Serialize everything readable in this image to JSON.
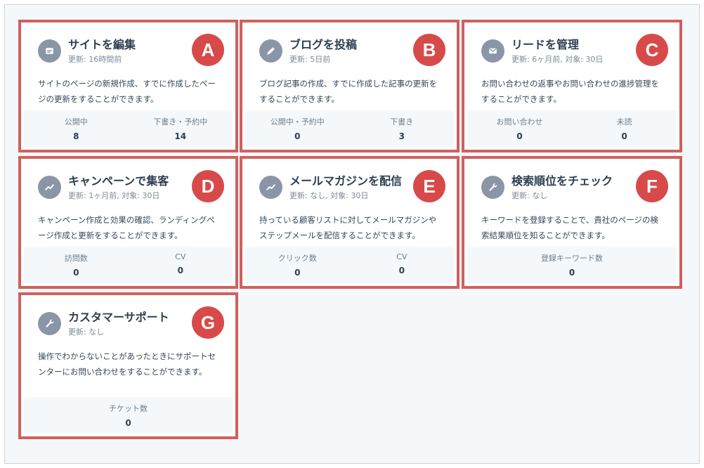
{
  "cards": [
    {
      "title": "サイトを編集",
      "updated": "更新: 16時間前",
      "description": "サイトのページの新規作成、すでに作成したページの更新をすることができます。",
      "badge": "A",
      "icon": "page-icon",
      "stats": [
        {
          "label": "公開中",
          "value": "8"
        },
        {
          "label": "下書き・予約中",
          "value": "14"
        }
      ]
    },
    {
      "title": "ブログを投稿",
      "updated": "更新: 5日前",
      "description": "ブログ記事の作成、すでに作成した記事の更新をすることができます。",
      "badge": "B",
      "icon": "pencil-icon",
      "stats": [
        {
          "label": "公開中・予約中",
          "value": "0"
        },
        {
          "label": "下書き",
          "value": "3"
        }
      ]
    },
    {
      "title": "リードを管理",
      "updated": "更新: 6ヶ月前, 対象: 30日",
      "description": "お問い合わせの返事やお問い合わせの進捗管理をすることができます。",
      "badge": "C",
      "icon": "envelope-icon",
      "stats": [
        {
          "label": "お問い合わせ",
          "value": "0"
        },
        {
          "label": "未読",
          "value": "0"
        }
      ]
    },
    {
      "title": "キャンペーンで集客",
      "updated": "更新: 1ヶ月前, 対象: 30日",
      "description": "キャンペーン作成と効果の確認、ランディングページ作成と更新をすることができます。",
      "badge": "D",
      "icon": "trend-icon",
      "stats": [
        {
          "label": "訪問数",
          "value": "0"
        },
        {
          "label": "CV",
          "value": "0"
        }
      ]
    },
    {
      "title": "メールマガジンを配信",
      "updated": "更新: なし, 対象: 30日",
      "description": "持っている顧客リストに対してメールマガジンやステップメールを配信することができます。",
      "badge": "E",
      "icon": "trend-icon",
      "stats": [
        {
          "label": "クリック数",
          "value": "0"
        },
        {
          "label": "CV",
          "value": "0"
        }
      ]
    },
    {
      "title": "検索順位をチェック",
      "updated": "更新: なし",
      "description": "キーワードを登録することで、貴社のページの検索結果順位を知ることができます。",
      "badge": "F",
      "icon": "wrench-icon",
      "stats": [
        {
          "label": "登録キーワード数",
          "value": "0"
        }
      ]
    },
    {
      "title": "カスタマーサポート",
      "updated": "更新: なし",
      "description": "操作でわからないことがあったときにサポートセンターにお問い合わせをすることができます。",
      "badge": "G",
      "icon": "wrench-icon",
      "stats": [
        {
          "label": "チケット数",
          "value": "0"
        }
      ]
    }
  ],
  "colors": {
    "highlight_border": "#d0605f",
    "badge": "#d84a4a",
    "icon_bg": "#8a96a8"
  }
}
